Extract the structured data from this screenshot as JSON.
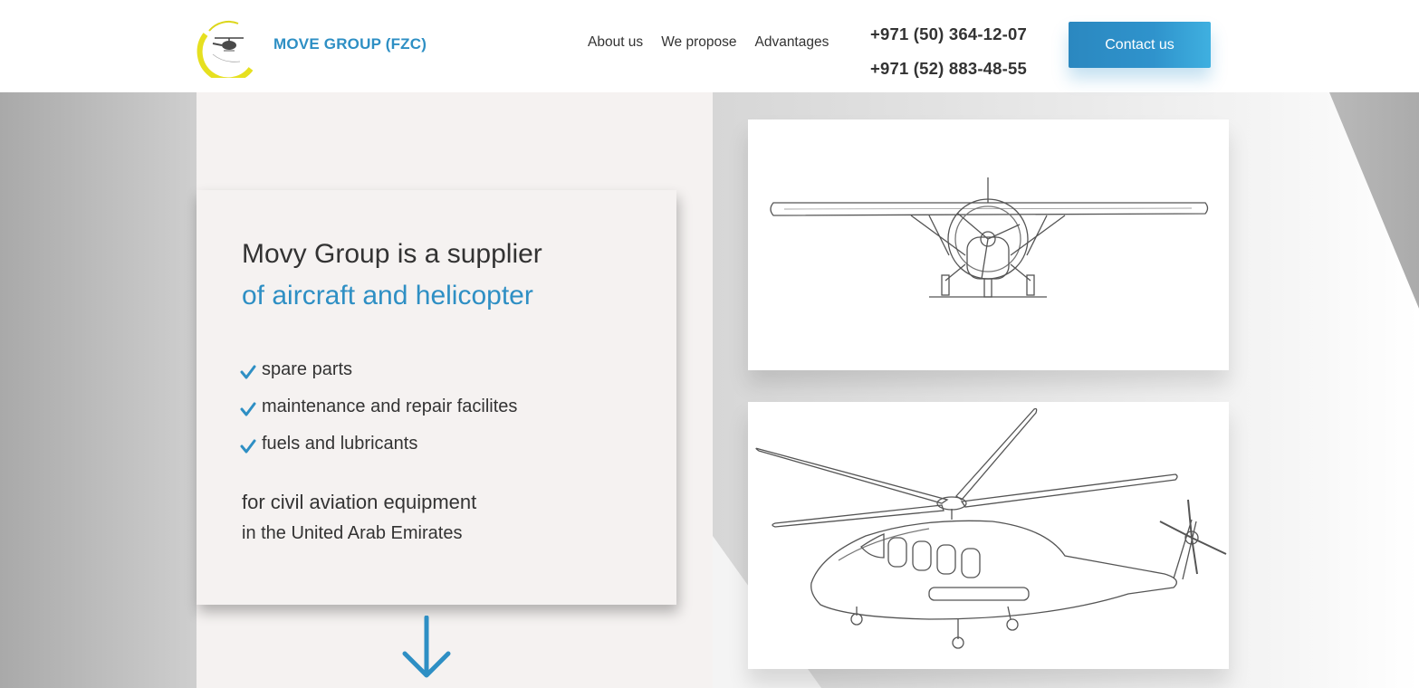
{
  "header": {
    "brand": "MOVE GROUP (FZC)",
    "logo_icon": "helicopter-logo-icon",
    "nav": [
      {
        "label": "About us"
      },
      {
        "label": "We propose"
      },
      {
        "label": "Advantages"
      }
    ],
    "phones": [
      "+971 (50) 364-12-07",
      "+971 (52) 883-48-55"
    ],
    "contact_label": "Contact us"
  },
  "hero": {
    "headline_line1": "Movy Group is a supplier",
    "headline_line2": "of aircraft and helicopter",
    "items": [
      "spare parts",
      "maintenance and repair facilites",
      "fuels and lubricants"
    ],
    "tagline_line1": "for civil aviation equipment",
    "tagline_line2": "in the United Arab Emirates",
    "check_icon": "checkmark-icon",
    "scroll_icon": "arrow-down-icon"
  },
  "images": {
    "top": "airplane-front-illustration",
    "bottom": "helicopter-illustration"
  },
  "colors": {
    "accent": "#2e8fc4",
    "text": "#333333",
    "card_bg": "#f5f2f1",
    "button_gradient_start": "#2b88c0",
    "button_gradient_end": "#3fb0e0"
  }
}
